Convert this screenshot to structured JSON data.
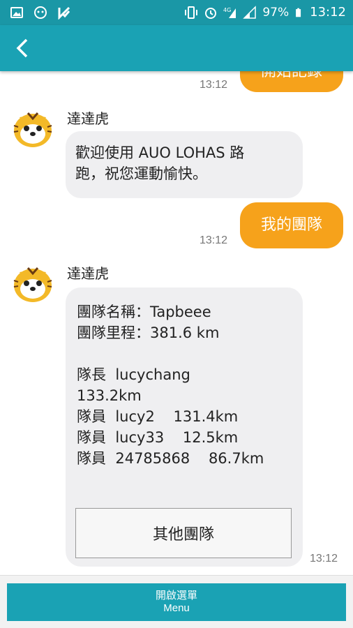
{
  "status": {
    "battery": "97%",
    "time": "13:12"
  },
  "appbar": {
    "back_icon": "chevron-left-icon"
  },
  "messages": {
    "m0": {
      "text": "開始記錄",
      "time": "13:12"
    },
    "m1": {
      "sender": "達達虎",
      "text_line1": "歡迎使用 AUO LOHAS 路",
      "text_line2": "跑，祝您運動愉快。"
    },
    "m2": {
      "text": "我的團隊",
      "time": "13:12"
    },
    "m3": {
      "sender": "達達虎",
      "lines": [
        "團隊名稱：Tapbeee",
        "團隊里程：381.6 km",
        "",
        "隊長  lucychang",
        "133.2km",
        "隊員  lucy2    131.4km",
        "隊員  lucy33    12.5km",
        "隊員  24785868    86.7km"
      ],
      "button": "其他團隊",
      "time": "13:12"
    }
  },
  "bottom": {
    "menu_line1": "開啟選單",
    "menu_line2": "Menu"
  }
}
